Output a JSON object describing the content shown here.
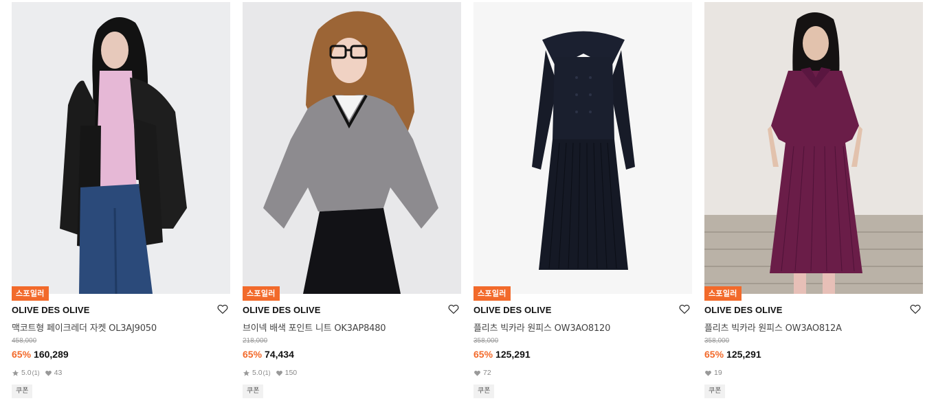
{
  "products": [
    {
      "badge": "스포일러",
      "brand": "OLIVE DES OLIVE",
      "name": "맥코트형 페이크레더 자켓 OL3AJ9050",
      "original_price": "458,000",
      "discount": "65%",
      "price": "160,289",
      "rating": "5.0",
      "review_count": "(1)",
      "likes": "43",
      "coupon": "쿠폰",
      "photo_subject": "model in black faux-leather jacket, pink turtleneck, blue jeans"
    },
    {
      "badge": "스포일러",
      "brand": "OLIVE DES OLIVE",
      "name": "브이넥 배색 포인트 니트 OK3AP8480",
      "original_price": "218,000",
      "discount": "65%",
      "price": "74,434",
      "rating": "5.0",
      "review_count": "(1)",
      "likes": "150",
      "coupon": "쿠폰",
      "photo_subject": "model with glasses in grey v-neck knit, black skirt"
    },
    {
      "badge": "스포일러",
      "brand": "OLIVE DES OLIVE",
      "name": "플리츠 빅카라 원피스 OW3AO8120",
      "original_price": "358,000",
      "discount": "65%",
      "price": "125,291",
      "likes": "72",
      "coupon": "쿠폰",
      "photo_subject": "navy pleated dress with big collar, flat lay"
    },
    {
      "badge": "스포일러",
      "brand": "OLIVE DES OLIVE",
      "name": "플리츠 빅카라 원피스 OW3AO812A",
      "original_price": "358,000",
      "discount": "65%",
      "price": "125,291",
      "likes": "19",
      "coupon": "쿠폰",
      "photo_subject": "model in burgundy pleated dress with big collar"
    }
  ],
  "colors": {
    "accent": "#f26a2b",
    "badge_bg": "#f26a2b",
    "coupon_bg": "#f1f1f1"
  },
  "icons": {
    "wish": "heart-outline-icon",
    "star": "star-icon",
    "like": "heart-filled-icon"
  }
}
